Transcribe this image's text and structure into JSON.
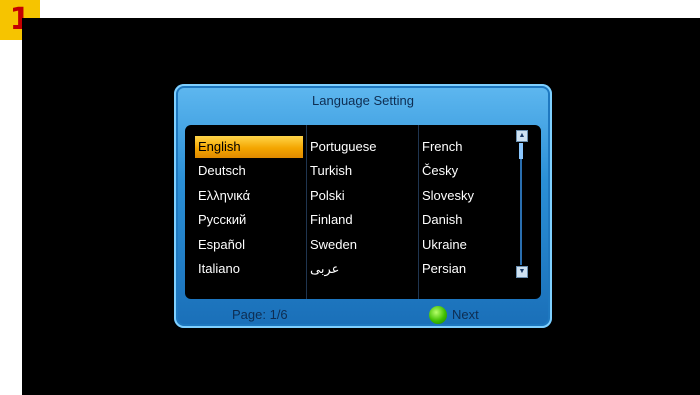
{
  "step_badge": "1",
  "dialog": {
    "title": "Language Setting",
    "columns": [
      [
        "English",
        "Deutsch",
        "Ελληνικά",
        "Русский",
        "Español",
        "Italiano"
      ],
      [
        "Portuguese",
        "Turkish",
        "Polski",
        "Finland",
        "Sweden",
        "عربى"
      ],
      [
        "French",
        "Česky",
        "Slovesky",
        "Danish",
        "Ukraine",
        "Persian"
      ]
    ],
    "selected": "English"
  },
  "scrollbar": {
    "up_icon": "scroll-up-icon",
    "down_icon": "scroll-down-icon"
  },
  "footer": {
    "page": "Page: 1/6",
    "next_label": "Next",
    "next_button_color": "#3fbf00"
  },
  "colors": {
    "dialog_blue": "#2a8fd6",
    "selection_orange": "#f4a600",
    "badge_yellow": "#f6c400",
    "badge_text_red": "#c40000"
  }
}
